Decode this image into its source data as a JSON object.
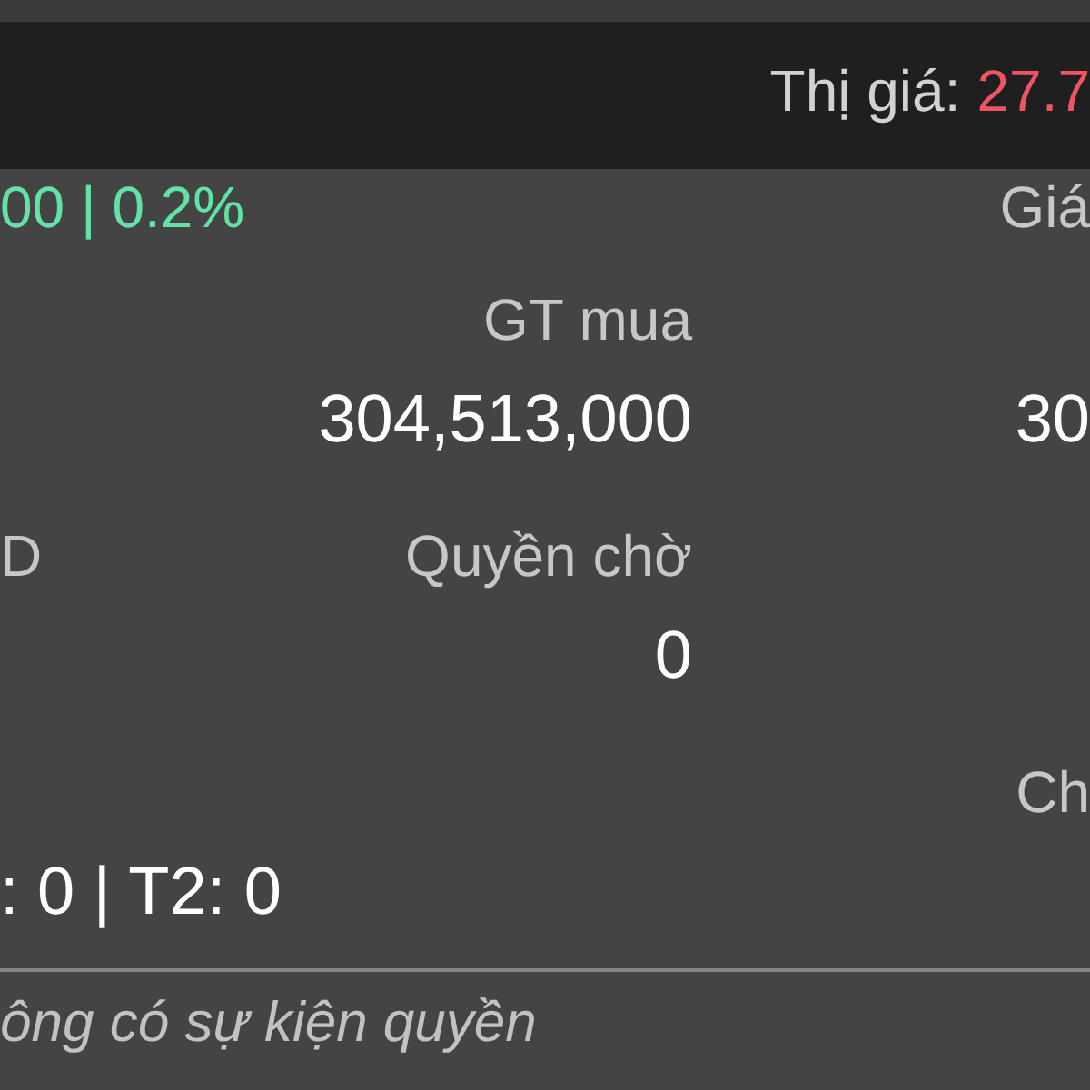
{
  "header": {
    "price": {
      "label": "Thị giá:",
      "value": "27.7",
      "rising": false
    }
  },
  "rows": [
    {
      "column_1": {
        "text": "00 | 0.2%",
        "kind": "change",
        "rising": true
      },
      "column_3": {
        "text": "Giá",
        "kind": "label"
      }
    },
    {
      "column_2": {
        "text": "GT mua",
        "kind": "label"
      }
    },
    {
      "column_2": {
        "text": "304,513,000",
        "kind": "value"
      },
      "column_3": {
        "text": "30",
        "kind": "value"
      }
    },
    {
      "column_1": {
        "text": "D",
        "kind": "label"
      },
      "column_2": {
        "text": "Quyền chờ",
        "kind": "label"
      }
    },
    {
      "column_2": {
        "text": "0",
        "kind": "value"
      }
    },
    {
      "column_3": {
        "text": "Ch",
        "kind": "label"
      }
    },
    {
      "column_1": {
        "text": ": 0 | T2: 0",
        "kind": "value"
      }
    }
  ],
  "note": "ông có sự kiện quyền"
}
